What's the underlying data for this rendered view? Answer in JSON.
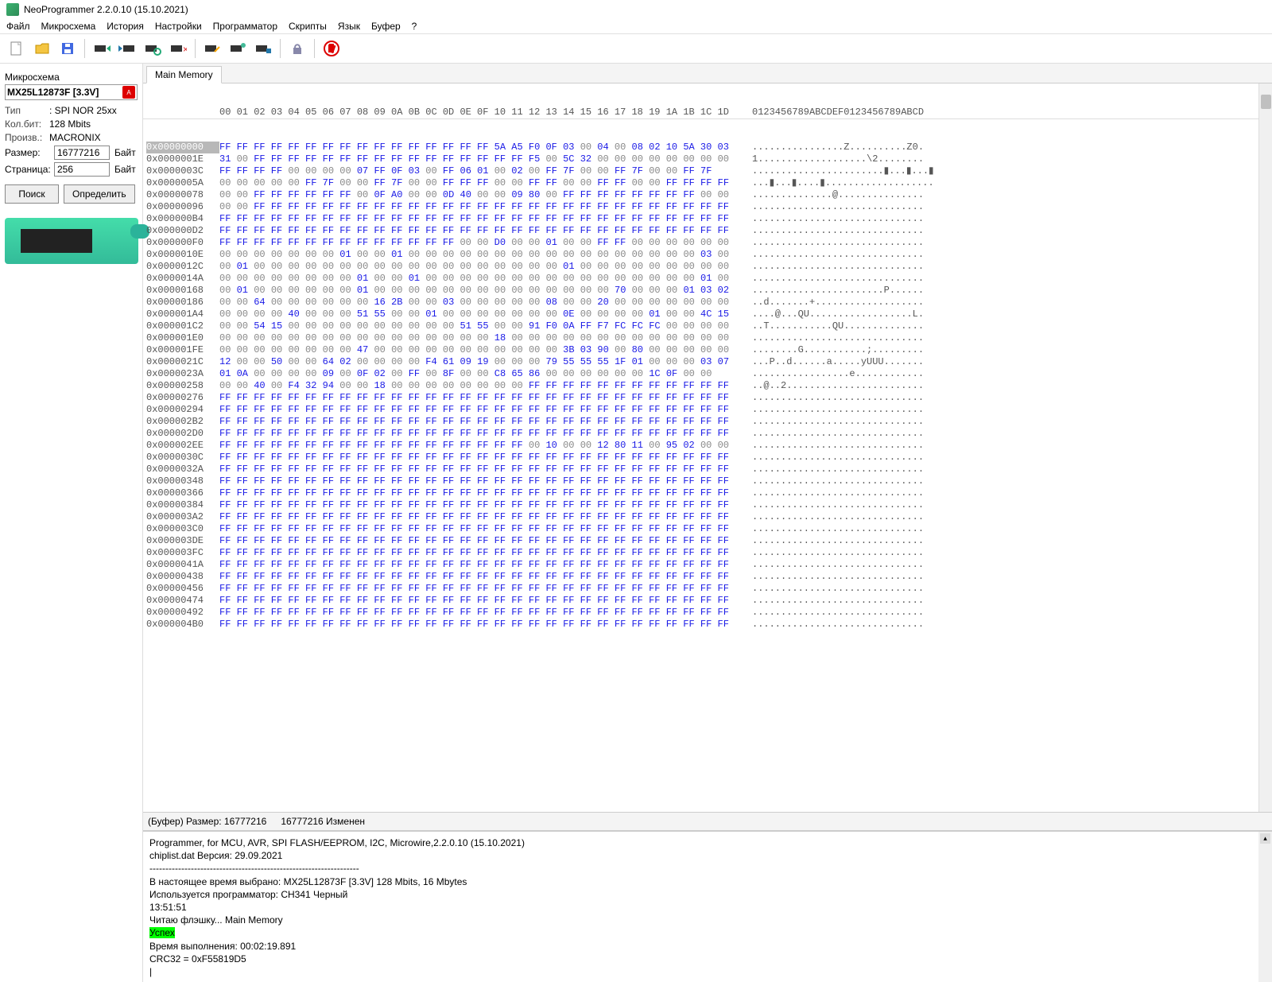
{
  "title": "NeoProgrammer 2.2.0.10 (15.10.2021)",
  "menu": [
    "Файл",
    "Микросхема",
    "История",
    "Настройки",
    "Программатор",
    "Скрипты",
    "Язык",
    "Буфер",
    "?"
  ],
  "toolbar_icons": [
    "new-file",
    "open-file",
    "save-file",
    "chip-read",
    "chip-write",
    "chip-verify",
    "chip-erase",
    "chip-blank",
    "chip-conn1",
    "chip-conn2",
    "lock",
    "stop"
  ],
  "sidebar": {
    "section_label": "Микросхема",
    "chip_name": "MX25L12873F [3.3V]",
    "type_label": "Тип",
    "type_value": ": SPI NOR 25xx",
    "bits_label": "Кол.бит:",
    "bits_value": "128 Mbits",
    "vendor_label": "Произв.:",
    "vendor_value": "MACRONIX",
    "size_label": "Размер:",
    "size_value": "16777216",
    "size_unit": "Байт",
    "page_label": "Страница:",
    "page_value": "256",
    "page_unit": "Байт",
    "search_btn": "Поиск",
    "detect_btn": "Определить"
  },
  "tab": "Main Memory",
  "hex_header_offsets": "00 01 02 03 04 05 06 07 08 09 0A 0B 0C 0D 0E 0F 10 11 12 13 14 15 16 17 18 19 1A 1B 1C 1D",
  "hex_header_ascii": "0123456789ABCDEF0123456789ABCD",
  "rows": [
    {
      "addr": "0x00000000",
      "sel": true,
      "b": "FF FF FF FF FF FF FF FF FF FF FF FF FF FF FF FF 5A A5 F0 0F 03 00 04 00 08 02 10 5A 30 03",
      "a": "................Z..........Z0."
    },
    {
      "addr": "0x0000001E",
      "b": "31 00 FF FF FF FF FF FF FF FF FF FF FF FF FF FF FF FF F5 00 5C 32 00 00 00 00 00 00 00 00",
      "a": "1...................\\2........"
    },
    {
      "addr": "0x0000003C",
      "b": "FF FF FF FF 00 00 00 00 07 FF 0F 03 00 FF 06 01 00 02 00 FF 7F 00 00 FF 7F 00 00 FF 7F",
      "a": ".......................▮...▮...▮"
    },
    {
      "addr": "0x0000005A",
      "b": "00 00 00 00 00 FF 7F 00 00 FF 7F 00 00 FF FF FF 00 00 FF FF 00 00 FF FF 00 00 FF FF FF FF",
      "a": "...▮...▮....▮..................."
    },
    {
      "addr": "0x00000078",
      "b": "00 00 FF FF FF FF FF FF 00 0F A0 00 00 0D 40 00 00 09 80 00 FF FF FF FF FF FF FF FF 00 00",
      "a": "..............@..............."
    },
    {
      "addr": "0x00000096",
      "b": "00 00 FF FF FF FF FF FF FF FF FF FF FF FF FF FF FF FF FF FF FF FF FF FF FF FF FF FF FF FF",
      "a": ".............................."
    },
    {
      "addr": "0x000000B4",
      "b": "FF FF FF FF FF FF FF FF FF FF FF FF FF FF FF FF FF FF FF FF FF FF FF FF FF FF FF FF FF FF",
      "a": ".............................."
    },
    {
      "addr": "0x000000D2",
      "b": "FF FF FF FF FF FF FF FF FF FF FF FF FF FF FF FF FF FF FF FF FF FF FF FF FF FF FF FF FF FF",
      "a": ".............................."
    },
    {
      "addr": "0x000000F0",
      "b": "FF FF FF FF FF FF FF FF FF FF FF FF FF FF 00 00 D0 00 00 01 00 00 FF FF 00 00 00 00 00 00",
      "a": ".............................."
    },
    {
      "addr": "0x0000010E",
      "b": "00 00 00 00 00 00 00 01 00 00 01 00 00 00 00 00 00 00 00 00 00 00 00 00 00 00 00 00 03 00",
      "a": ".............................."
    },
    {
      "addr": "0x0000012C",
      "b": "00 01 00 00 00 00 00 00 00 00 00 00 00 00 00 00 00 00 00 00 01 00 00 00 00 00 00 00 00 00",
      "a": ".............................."
    },
    {
      "addr": "0x0000014A",
      "b": "00 00 00 00 00 00 00 00 01 00 00 01 00 00 00 00 00 00 00 00 00 00 00 00 00 00 00 00 01 00",
      "a": ".............................."
    },
    {
      "addr": "0x00000168",
      "b": "00 01 00 00 00 00 00 00 01 00 00 00 00 00 00 00 00 00 00 00 00 00 00 70 00 00 00 01 03 02",
      "a": ".......................P......"
    },
    {
      "addr": "0x00000186",
      "b": "00 00 64 00 00 00 00 00 00 16 2B 00 00 03 00 00 00 00 00 08 00 00 20 00 00 00 00 00 00 00",
      "a": "..d.......+..................."
    },
    {
      "addr": "0x000001A4",
      "b": "00 00 00 00 40 00 00 00 51 55 00 00 01 00 00 00 00 00 00 00 0E 00 00 00 00 01 00 00 4C 15",
      "a": "....@...QU..................L."
    },
    {
      "addr": "0x000001C2",
      "b": "00 00 54 15 00 00 00 00 00 00 00 00 00 00 51 55 00 00 91 F0 0A FF F7 FC FC FC 00 00 00 00",
      "a": "..T...........QU.............."
    },
    {
      "addr": "0x000001E0",
      "b": "00 00 00 00 00 00 00 00 00 00 00 00 00 00 00 00 18 00 00 00 00 00 00 00 00 00 00 00 00 00",
      "a": ".............................."
    },
    {
      "addr": "0x000001FE",
      "b": "00 00 00 00 00 00 00 00 47 00 00 00 00 00 00 00 00 00 00 00 3B 03 90 00 80 00 00 00 00 00",
      "a": "........G...........;........."
    },
    {
      "addr": "0x0000021C",
      "b": "12 00 00 50 00 00 64 02 00 00 00 00 F4 61 09 19 00 00 00 79 55 55 55 1F 01 00 00 00 03 07",
      "a": "...P..d......a.....yUUU......."
    },
    {
      "addr": "0x0000023A",
      "b": "01 0A 00 00 00 00 09 00 0F 02 00 FF 00 8F 00 00 C8 65 86 00 00 00 00 00 00 1C 0F 00 00",
      "a": ".................e............"
    },
    {
      "addr": "0x00000258",
      "b": "00 00 40 00 F4 32 94 00 00 18 00 00 00 00 00 00 00 00 FF FF FF FF FF FF FF FF FF FF FF FF",
      "a": "..@..2........................"
    },
    {
      "addr": "0x00000276",
      "b": "FF FF FF FF FF FF FF FF FF FF FF FF FF FF FF FF FF FF FF FF FF FF FF FF FF FF FF FF FF FF",
      "a": ".............................."
    },
    {
      "addr": "0x00000294",
      "b": "FF FF FF FF FF FF FF FF FF FF FF FF FF FF FF FF FF FF FF FF FF FF FF FF FF FF FF FF FF FF",
      "a": ".............................."
    },
    {
      "addr": "0x000002B2",
      "b": "FF FF FF FF FF FF FF FF FF FF FF FF FF FF FF FF FF FF FF FF FF FF FF FF FF FF FF FF FF FF",
      "a": ".............................."
    },
    {
      "addr": "0x000002D0",
      "b": "FF FF FF FF FF FF FF FF FF FF FF FF FF FF FF FF FF FF FF FF FF FF FF FF FF FF FF FF FF FF",
      "a": ".............................."
    },
    {
      "addr": "0x000002EE",
      "b": "FF FF FF FF FF FF FF FF FF FF FF FF FF FF FF FF FF FF 00 10 00 00 12 80 11 00 95 02 00 00",
      "a": ".............................."
    },
    {
      "addr": "0x0000030C",
      "b": "FF FF FF FF FF FF FF FF FF FF FF FF FF FF FF FF FF FF FF FF FF FF FF FF FF FF FF FF FF FF",
      "a": ".............................."
    },
    {
      "addr": "0x0000032A",
      "b": "FF FF FF FF FF FF FF FF FF FF FF FF FF FF FF FF FF FF FF FF FF FF FF FF FF FF FF FF FF FF",
      "a": ".............................."
    },
    {
      "addr": "0x00000348",
      "b": "FF FF FF FF FF FF FF FF FF FF FF FF FF FF FF FF FF FF FF FF FF FF FF FF FF FF FF FF FF FF",
      "a": ".............................."
    },
    {
      "addr": "0x00000366",
      "b": "FF FF FF FF FF FF FF FF FF FF FF FF FF FF FF FF FF FF FF FF FF FF FF FF FF FF FF FF FF FF",
      "a": ".............................."
    },
    {
      "addr": "0x00000384",
      "b": "FF FF FF FF FF FF FF FF FF FF FF FF FF FF FF FF FF FF FF FF FF FF FF FF FF FF FF FF FF FF",
      "a": ".............................."
    },
    {
      "addr": "0x000003A2",
      "b": "FF FF FF FF FF FF FF FF FF FF FF FF FF FF FF FF FF FF FF FF FF FF FF FF FF FF FF FF FF FF",
      "a": ".............................."
    },
    {
      "addr": "0x000003C0",
      "b": "FF FF FF FF FF FF FF FF FF FF FF FF FF FF FF FF FF FF FF FF FF FF FF FF FF FF FF FF FF FF",
      "a": ".............................."
    },
    {
      "addr": "0x000003DE",
      "b": "FF FF FF FF FF FF FF FF FF FF FF FF FF FF FF FF FF FF FF FF FF FF FF FF FF FF FF FF FF FF",
      "a": ".............................."
    },
    {
      "addr": "0x000003FC",
      "b": "FF FF FF FF FF FF FF FF FF FF FF FF FF FF FF FF FF FF FF FF FF FF FF FF FF FF FF FF FF FF",
      "a": ".............................."
    },
    {
      "addr": "0x0000041A",
      "b": "FF FF FF FF FF FF FF FF FF FF FF FF FF FF FF FF FF FF FF FF FF FF FF FF FF FF FF FF FF FF",
      "a": ".............................."
    },
    {
      "addr": "0x00000438",
      "b": "FF FF FF FF FF FF FF FF FF FF FF FF FF FF FF FF FF FF FF FF FF FF FF FF FF FF FF FF FF FF",
      "a": ".............................."
    },
    {
      "addr": "0x00000456",
      "b": "FF FF FF FF FF FF FF FF FF FF FF FF FF FF FF FF FF FF FF FF FF FF FF FF FF FF FF FF FF FF",
      "a": ".............................."
    },
    {
      "addr": "0x00000474",
      "b": "FF FF FF FF FF FF FF FF FF FF FF FF FF FF FF FF FF FF FF FF FF FF FF FF FF FF FF FF FF FF",
      "a": ".............................."
    },
    {
      "addr": "0x00000492",
      "b": "FF FF FF FF FF FF FF FF FF FF FF FF FF FF FF FF FF FF FF FF FF FF FF FF FF FF FF FF FF FF",
      "a": ".............................."
    },
    {
      "addr": "0x000004B0",
      "b": "FF FF FF FF FF FF FF FF FF FF FF FF FF FF FF FF FF FF FF FF FF FF FF FF FF FF FF FF FF FF",
      "a": ".............................."
    }
  ],
  "status": {
    "buf": "(Буфер) Размер: 16777216",
    "mod": "16777216 Изменен"
  },
  "log": [
    {
      "t": "Programmer, for MCU, AVR, SPI FLASH/EEPROM, I2C, Microwire,2.2.0.10 (15.10.2021)"
    },
    {
      "t": "chiplist.dat Версия: 29.09.2021"
    },
    {
      "t": "------------------------------------------------------------------",
      "dash": true
    },
    {
      "t": "В настоящее время выбрано:  MX25L12873F [3.3V] 128 Mbits, 16 Mbytes"
    },
    {
      "t": ""
    },
    {
      "t": "Используется программатор: CH341 Черный"
    },
    {
      "t": "13:51:51"
    },
    {
      "t": "Читаю флэшку... Main Memory"
    },
    {
      "t": "Успех",
      "success": true
    },
    {
      "t": "Время выполнения: 00:02:19.891"
    },
    {
      "t": "CRC32 = 0xF55819D5"
    }
  ]
}
